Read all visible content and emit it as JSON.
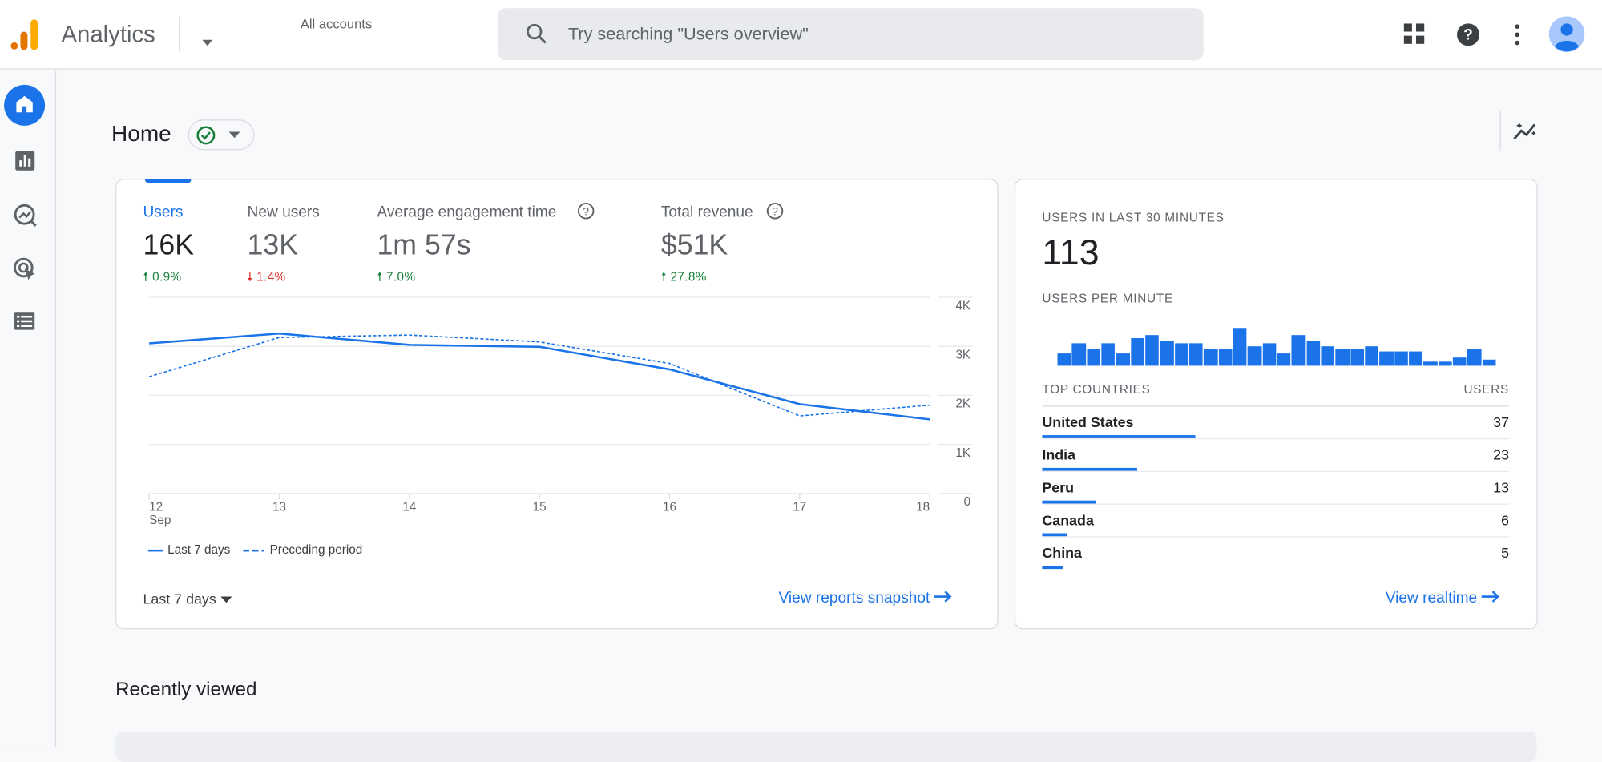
{
  "header": {
    "app_title": "Analytics",
    "account_label": "All accounts",
    "search_placeholder": "Try searching \"Users overview\"",
    "icons": [
      "analytics-logo-icon",
      "caret-down-icon",
      "search-icon",
      "apps-grid-icon",
      "help-icon",
      "more-vert-icon",
      "avatar-icon"
    ]
  },
  "sidebar": {
    "items": [
      {
        "name": "home",
        "icon": "home-icon",
        "active": true
      },
      {
        "name": "reports",
        "icon": "bar-chart-icon"
      },
      {
        "name": "explore",
        "icon": "explore-icon"
      },
      {
        "name": "advertising",
        "icon": "advertising-icon"
      },
      {
        "name": "configure",
        "icon": "list-icon"
      }
    ]
  },
  "page": {
    "title": "Home",
    "insights_icon": "insights-sparkle-icon"
  },
  "metrics": [
    {
      "label": "Users",
      "value": "16K",
      "change": "0.9%",
      "direction": "up",
      "help": false,
      "selected": true
    },
    {
      "label": "New users",
      "value": "13K",
      "change": "1.4%",
      "direction": "down",
      "help": false
    },
    {
      "label": "Average engagement time",
      "value": "1m 57s",
      "change": "7.0%",
      "direction": "up",
      "help": true
    },
    {
      "label": "Total revenue",
      "value": "$51K",
      "change": "27.8%",
      "direction": "up",
      "help": true
    }
  ],
  "chart_data": {
    "type": "line",
    "x": [
      "12",
      "13",
      "14",
      "15",
      "16",
      "17",
      "18"
    ],
    "x_sub_label": "Sep",
    "y_ticks": [
      "4K",
      "3K",
      "2K",
      "1K",
      "0"
    ],
    "ylim": [
      0,
      4000
    ],
    "grid": true,
    "legend_position": "bottom-left",
    "series": [
      {
        "name": "Last 7 days",
        "style": "solid",
        "values": [
          3060,
          3260,
          3030,
          2990,
          2530,
          1820,
          1510
        ]
      },
      {
        "name": "Preceding period",
        "style": "dashed",
        "values": [
          2380,
          3180,
          3230,
          3090,
          2650,
          1580,
          1800
        ]
      }
    ],
    "color": "#1a73e8"
  },
  "card_footer": {
    "range_label": "Last 7 days",
    "link": "View reports snapshot"
  },
  "realtime": {
    "title": "USERS IN LAST 30 MINUTES",
    "value": "113",
    "per_minute_label": "USERS PER MINUTE",
    "per_minute_values": [
      3.2,
      5.9,
      4.4,
      5.9,
      3.2,
      7.2,
      8.0,
      6.5,
      5.9,
      5.9,
      4.4,
      4.4,
      10,
      5.2,
      5.9,
      3.2,
      8.0,
      6.5,
      5.2,
      4.4,
      4.4,
      5.2,
      3.8,
      3.8,
      3.8,
      1.1,
      1.1,
      2.3,
      4.4,
      1.7
    ],
    "countries_header": "TOP COUNTRIES",
    "users_header": "USERS",
    "countries": [
      {
        "name": "United States",
        "users": "37"
      },
      {
        "name": "India",
        "users": "23"
      },
      {
        "name": "Peru",
        "users": "13"
      },
      {
        "name": "Canada",
        "users": "6"
      },
      {
        "name": "China",
        "users": "5"
      }
    ],
    "link": "View realtime"
  },
  "recent": {
    "title": "Recently viewed"
  }
}
